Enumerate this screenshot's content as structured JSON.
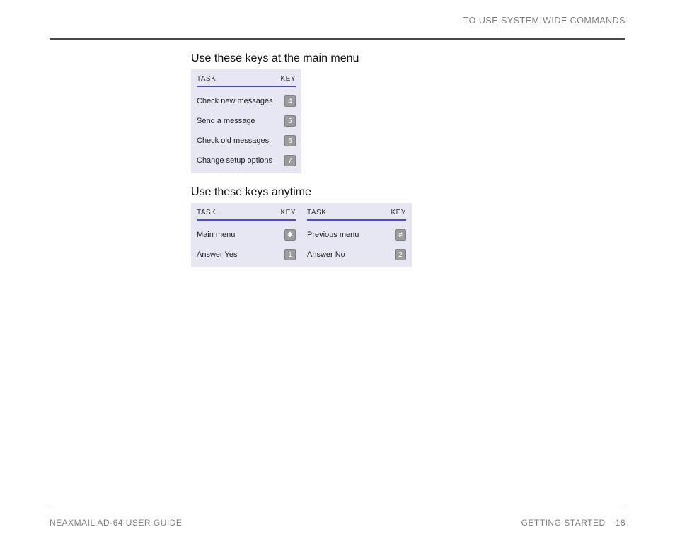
{
  "header": {
    "title": "TO USE SYSTEM-WIDE COMMANDS"
  },
  "section1": {
    "title": "Use these keys at the main menu",
    "columns": [
      {
        "head_task": "TASK",
        "head_key": "KEY",
        "rows": [
          {
            "task": "Check new messages",
            "key": "4"
          },
          {
            "task": "Send a message",
            "key": "5"
          },
          {
            "task": "Check old messages",
            "key": "6"
          },
          {
            "task": "Change setup options",
            "key": "7"
          }
        ]
      }
    ]
  },
  "section2": {
    "title": "Use these keys anytime",
    "columns": [
      {
        "head_task": "TASK",
        "head_key": "KEY",
        "rows": [
          {
            "task": "Main menu",
            "key": "✱"
          },
          {
            "task": "Answer Yes",
            "key": "1"
          }
        ]
      },
      {
        "head_task": "TASK",
        "head_key": "KEY",
        "rows": [
          {
            "task": "Previous menu",
            "key": "#"
          },
          {
            "task": "Answer No",
            "key": "2"
          }
        ]
      }
    ]
  },
  "footer": {
    "left": "NEAXMAIL AD-64 USER GUIDE",
    "right_section": "GETTING STARTED",
    "page": "18"
  }
}
